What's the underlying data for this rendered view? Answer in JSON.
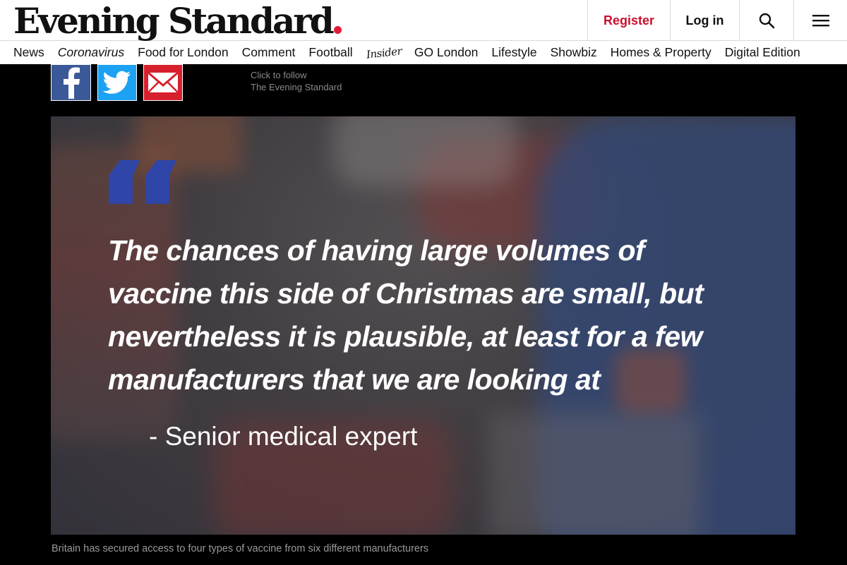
{
  "header": {
    "logo_text": "Evening Standard",
    "register_label": "Register",
    "login_label": "Log in"
  },
  "icons": {
    "search": "search-icon",
    "menu": "hamburger-menu-icon",
    "facebook": "facebook-icon",
    "twitter": "twitter-icon",
    "email": "email-icon"
  },
  "nav": {
    "items": [
      "News",
      "Coronavirus",
      "Food for London",
      "Comment",
      "Football",
      "Insider",
      "GO London",
      "Lifestyle",
      "Showbiz",
      "Homes & Property",
      "Digital Edition"
    ]
  },
  "follow": {
    "line1": "Click to follow",
    "line2": "The Evening Standard"
  },
  "quote": {
    "text": "The chances of having large volumes of vaccine this side of Christmas are small, but nevertheless it is plausible, at least for a few manufacturers that we are looking at",
    "attribution": "-  Senior medical expert"
  },
  "caption": "Britain has secured access to four types of vaccine from six different manufacturers",
  "colors": {
    "brand_red": "#c8102e",
    "quote_mark": "#2f45a8",
    "facebook": "#3b5998",
    "twitter": "#1da1f2",
    "email": "#d7202d"
  }
}
